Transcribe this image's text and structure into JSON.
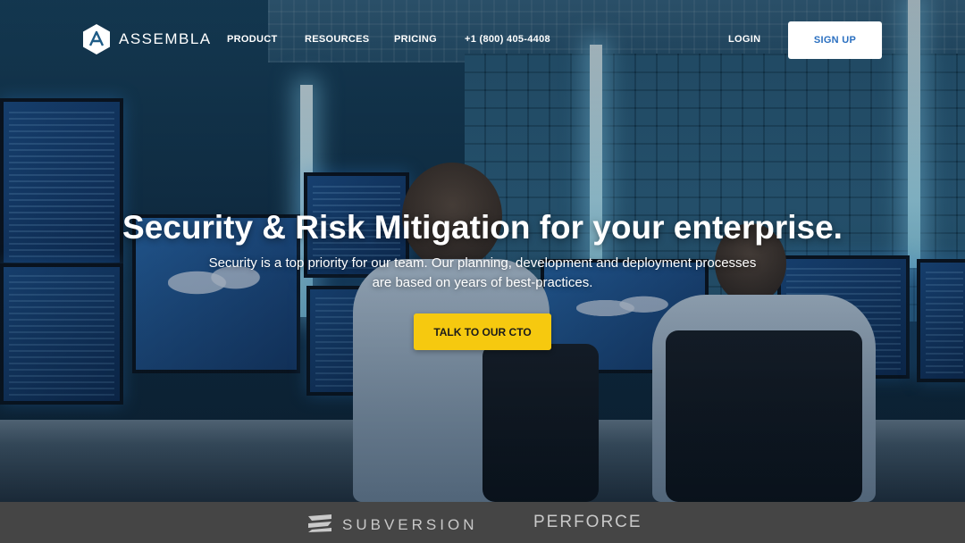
{
  "brand": {
    "name": "ASSEMBLA",
    "logo_icon": "assembla-hexagon-logo"
  },
  "nav": {
    "items": [
      {
        "label": "PRODUCT"
      },
      {
        "label": "RESOURCES"
      },
      {
        "label": "PRICING"
      },
      {
        "label": "+1 (800) 405-4408"
      }
    ],
    "login_label": "LOGIN",
    "signup_label": "SIGN UP"
  },
  "hero": {
    "headline": "Security & Risk Mitigation for your enterprise.",
    "subtext": "Security is a top priority for our team. Our planning, development and deployment processes are based on years of best-practices.",
    "cta_label": "TALK TO OUR CTO",
    "background_image": "security-operations-center-photo"
  },
  "partners": [
    {
      "name": "SUBVERSION",
      "icon": "subversion-logo"
    },
    {
      "name": "PERFORCE",
      "icon": ""
    }
  ],
  "colors": {
    "cta": "#f6c90f",
    "signup_text": "#2a6fc0",
    "strip_bg": "#454545"
  }
}
